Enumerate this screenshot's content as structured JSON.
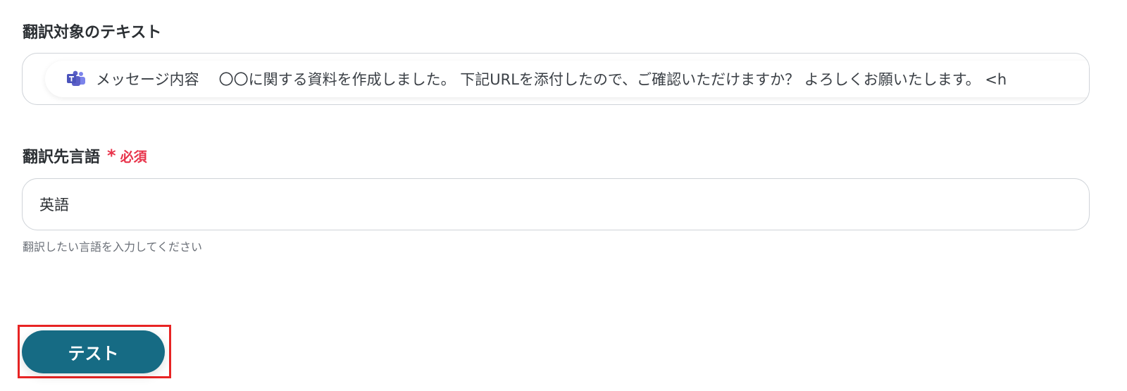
{
  "text_field": {
    "label": "翻訳対象のテキスト",
    "token": {
      "icon": "microsoft-teams-icon",
      "label": "メッセージ内容",
      "value": "〇〇に関する資料を作成しました。 下記URLを添付したので、ご確認いただけますか？ よろしくお願いたします。 <h"
    }
  },
  "language_field": {
    "label": "翻訳先言語",
    "required_mark": "*",
    "required_text": "必須",
    "value": "英語",
    "help": "翻訳したい言語を入力してください"
  },
  "actions": {
    "test_label": "テスト"
  },
  "colors": {
    "accent": "#166b84",
    "required": "#e8334a",
    "highlight": "#e82424",
    "teams": "#5b5fc7"
  }
}
